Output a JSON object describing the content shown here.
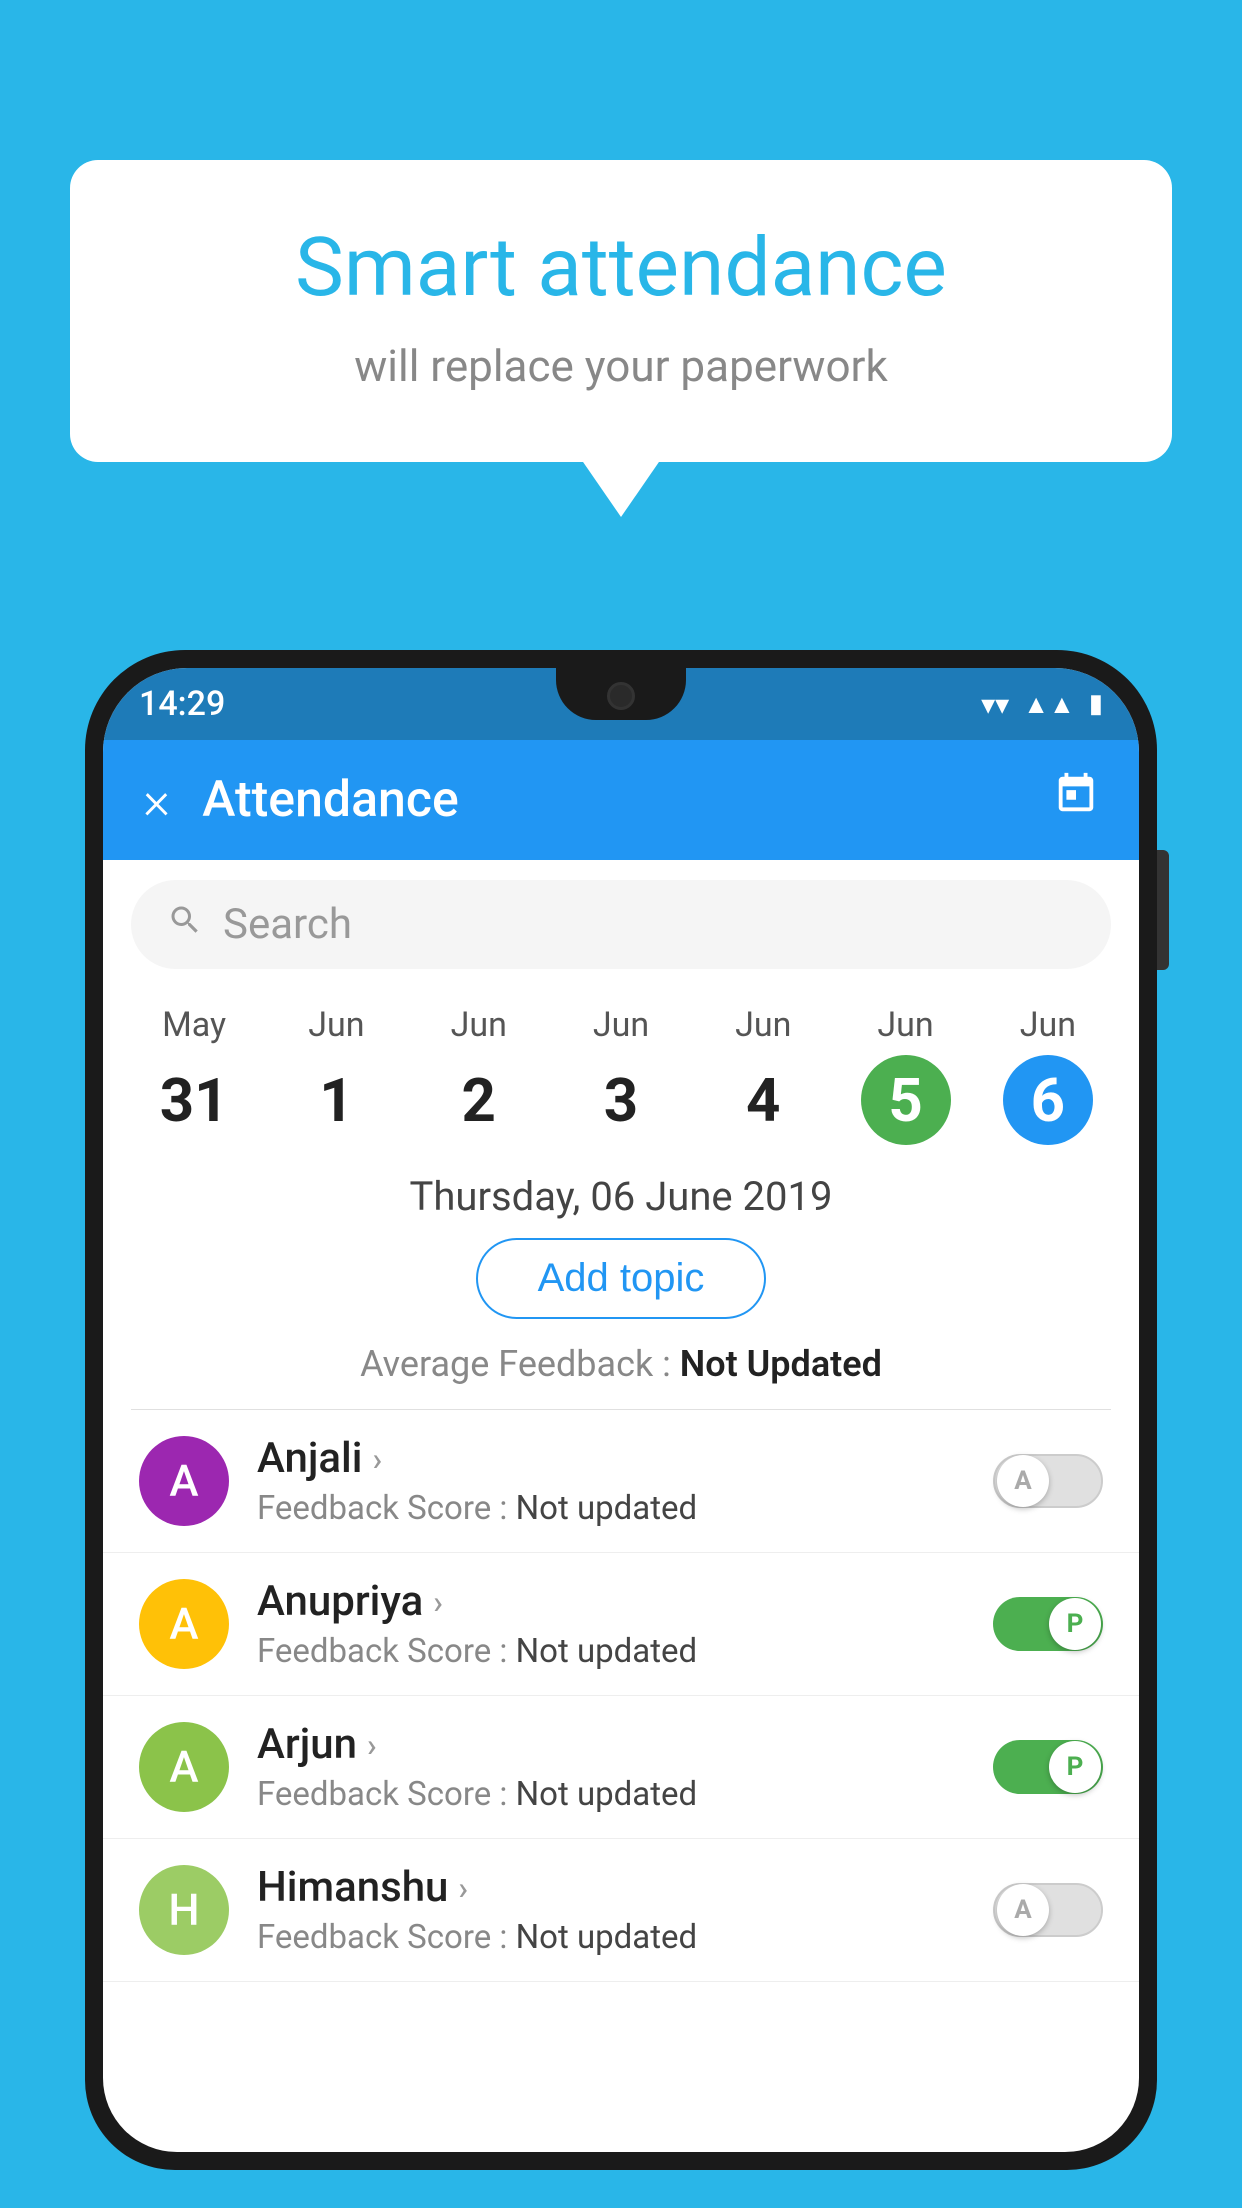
{
  "background_color": "#29b6e8",
  "speech_bubble": {
    "title": "Smart attendance",
    "subtitle": "will replace your paperwork"
  },
  "status_bar": {
    "time": "14:29",
    "icons": [
      "wifi",
      "signal",
      "battery"
    ]
  },
  "app_bar": {
    "title": "Attendance",
    "close_label": "×",
    "calendar_label": "📅"
  },
  "search": {
    "placeholder": "Search"
  },
  "calendar": {
    "days": [
      {
        "month": "May",
        "date": "31",
        "style": "normal"
      },
      {
        "month": "Jun",
        "date": "1",
        "style": "normal"
      },
      {
        "month": "Jun",
        "date": "2",
        "style": "normal"
      },
      {
        "month": "Jun",
        "date": "3",
        "style": "normal"
      },
      {
        "month": "Jun",
        "date": "4",
        "style": "normal"
      },
      {
        "month": "Jun",
        "date": "5",
        "style": "today"
      },
      {
        "month": "Jun",
        "date": "6",
        "style": "selected"
      }
    ]
  },
  "selected_date": "Thursday, 06 June 2019",
  "add_topic_label": "Add topic",
  "average_feedback": {
    "label": "Average Feedback : ",
    "value": "Not Updated"
  },
  "students": [
    {
      "name": "Anjali",
      "avatar_letter": "A",
      "avatar_color": "#9c27b0",
      "feedback_label": "Feedback Score : ",
      "feedback_value": "Not updated",
      "toggle_state": "off",
      "toggle_label": "A"
    },
    {
      "name": "Anupriya",
      "avatar_letter": "A",
      "avatar_color": "#ffc107",
      "feedback_label": "Feedback Score : ",
      "feedback_value": "Not updated",
      "toggle_state": "on",
      "toggle_label": "P"
    },
    {
      "name": "Arjun",
      "avatar_letter": "A",
      "avatar_color": "#8bc34a",
      "feedback_label": "Feedback Score : ",
      "feedback_value": "Not updated",
      "toggle_state": "on",
      "toggle_label": "P"
    },
    {
      "name": "Himanshu",
      "avatar_letter": "H",
      "avatar_color": "#9ccc65",
      "feedback_label": "Feedback Score : ",
      "feedback_value": "Not updated",
      "toggle_state": "off",
      "toggle_label": "A"
    }
  ]
}
